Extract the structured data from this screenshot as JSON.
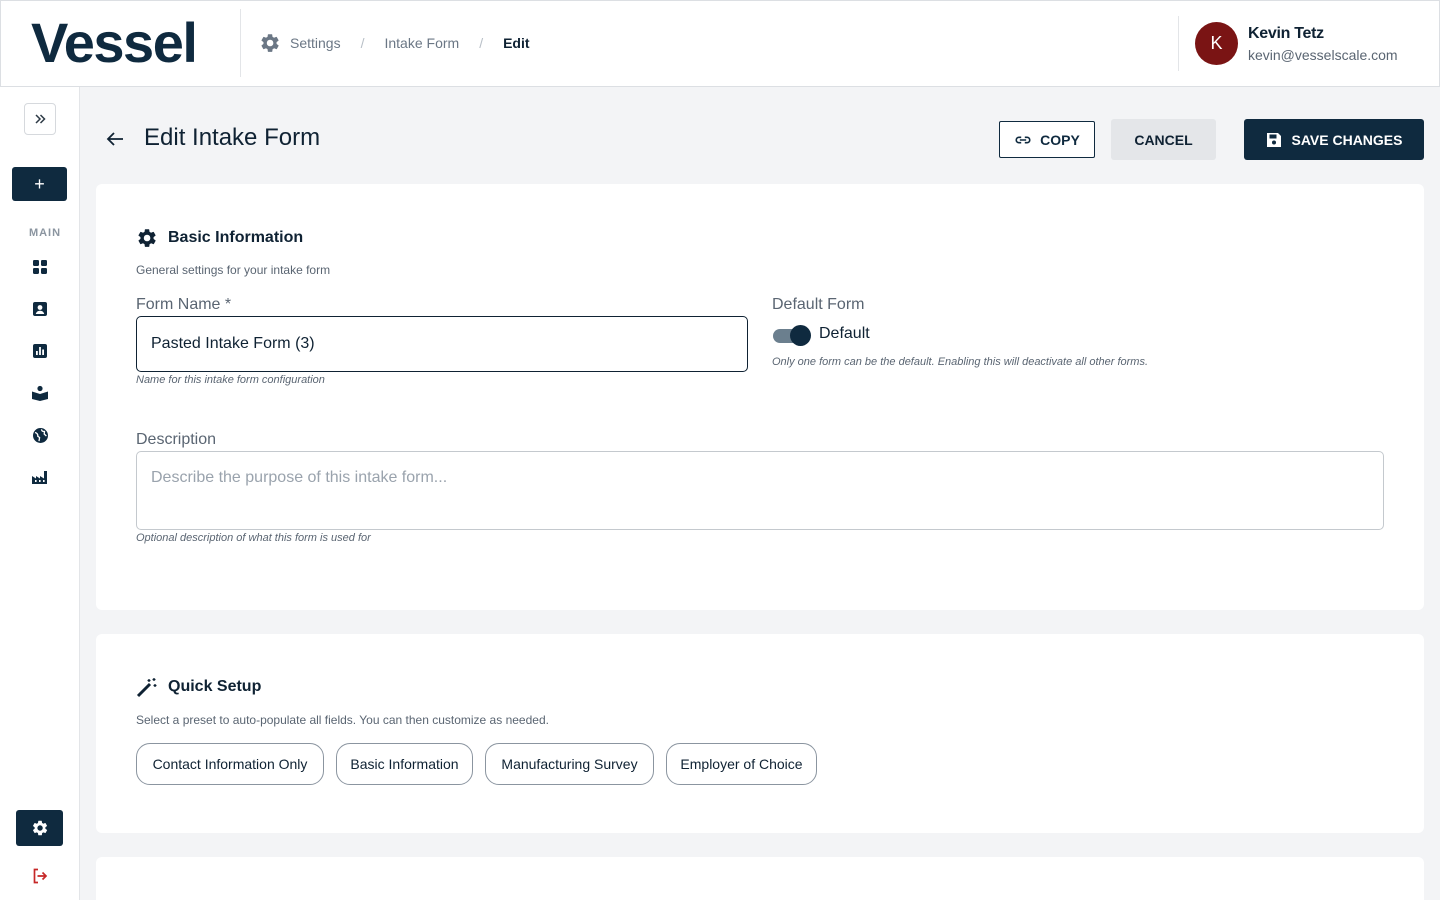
{
  "header": {
    "logo": "Vessel",
    "breadcrumb": {
      "settings": "Settings",
      "intake_form": "Intake Form",
      "edit": "Edit",
      "separator": "/"
    },
    "user": {
      "initial": "K",
      "name": "Kevin Tetz",
      "email": "kevin@vesselscale.com"
    }
  },
  "sidebar": {
    "add_label": "+",
    "section_label": "MAIN",
    "items": [
      {
        "icon": "dashboard-icon"
      },
      {
        "icon": "contacts-icon"
      },
      {
        "icon": "analytics-icon"
      },
      {
        "icon": "learning-icon"
      },
      {
        "icon": "globe-icon"
      },
      {
        "icon": "factory-icon"
      }
    ]
  },
  "page": {
    "title": "Edit Intake Form",
    "copy_label": "COPY",
    "cancel_label": "CANCEL",
    "save_label": "SAVE CHANGES"
  },
  "basic_info": {
    "title": "Basic Information",
    "subtitle": "General settings for your intake form",
    "form_name_label": "Form Name *",
    "form_name_value": "Pasted Intake Form (3)",
    "form_name_helper": "Name for this intake form configuration",
    "default_form_label": "Default Form",
    "default_toggle_label": "Default",
    "default_toggle_on": true,
    "default_helper": "Only one form can be the default. Enabling this will deactivate all other forms.",
    "description_label": "Description",
    "description_placeholder": "Describe the purpose of this intake form...",
    "description_helper": "Optional description of what this form is used for"
  },
  "quick_setup": {
    "title": "Quick Setup",
    "subtitle": "Select a preset to auto-populate all fields. You can then customize as needed.",
    "presets": [
      "Contact Information Only",
      "Basic Information",
      "Manufacturing Survey",
      "Employer of Choice"
    ]
  },
  "colors": {
    "primary": "#0f2a3f",
    "avatar": "#7a1414",
    "logout": "#c62828",
    "background": "#f3f4f6"
  }
}
